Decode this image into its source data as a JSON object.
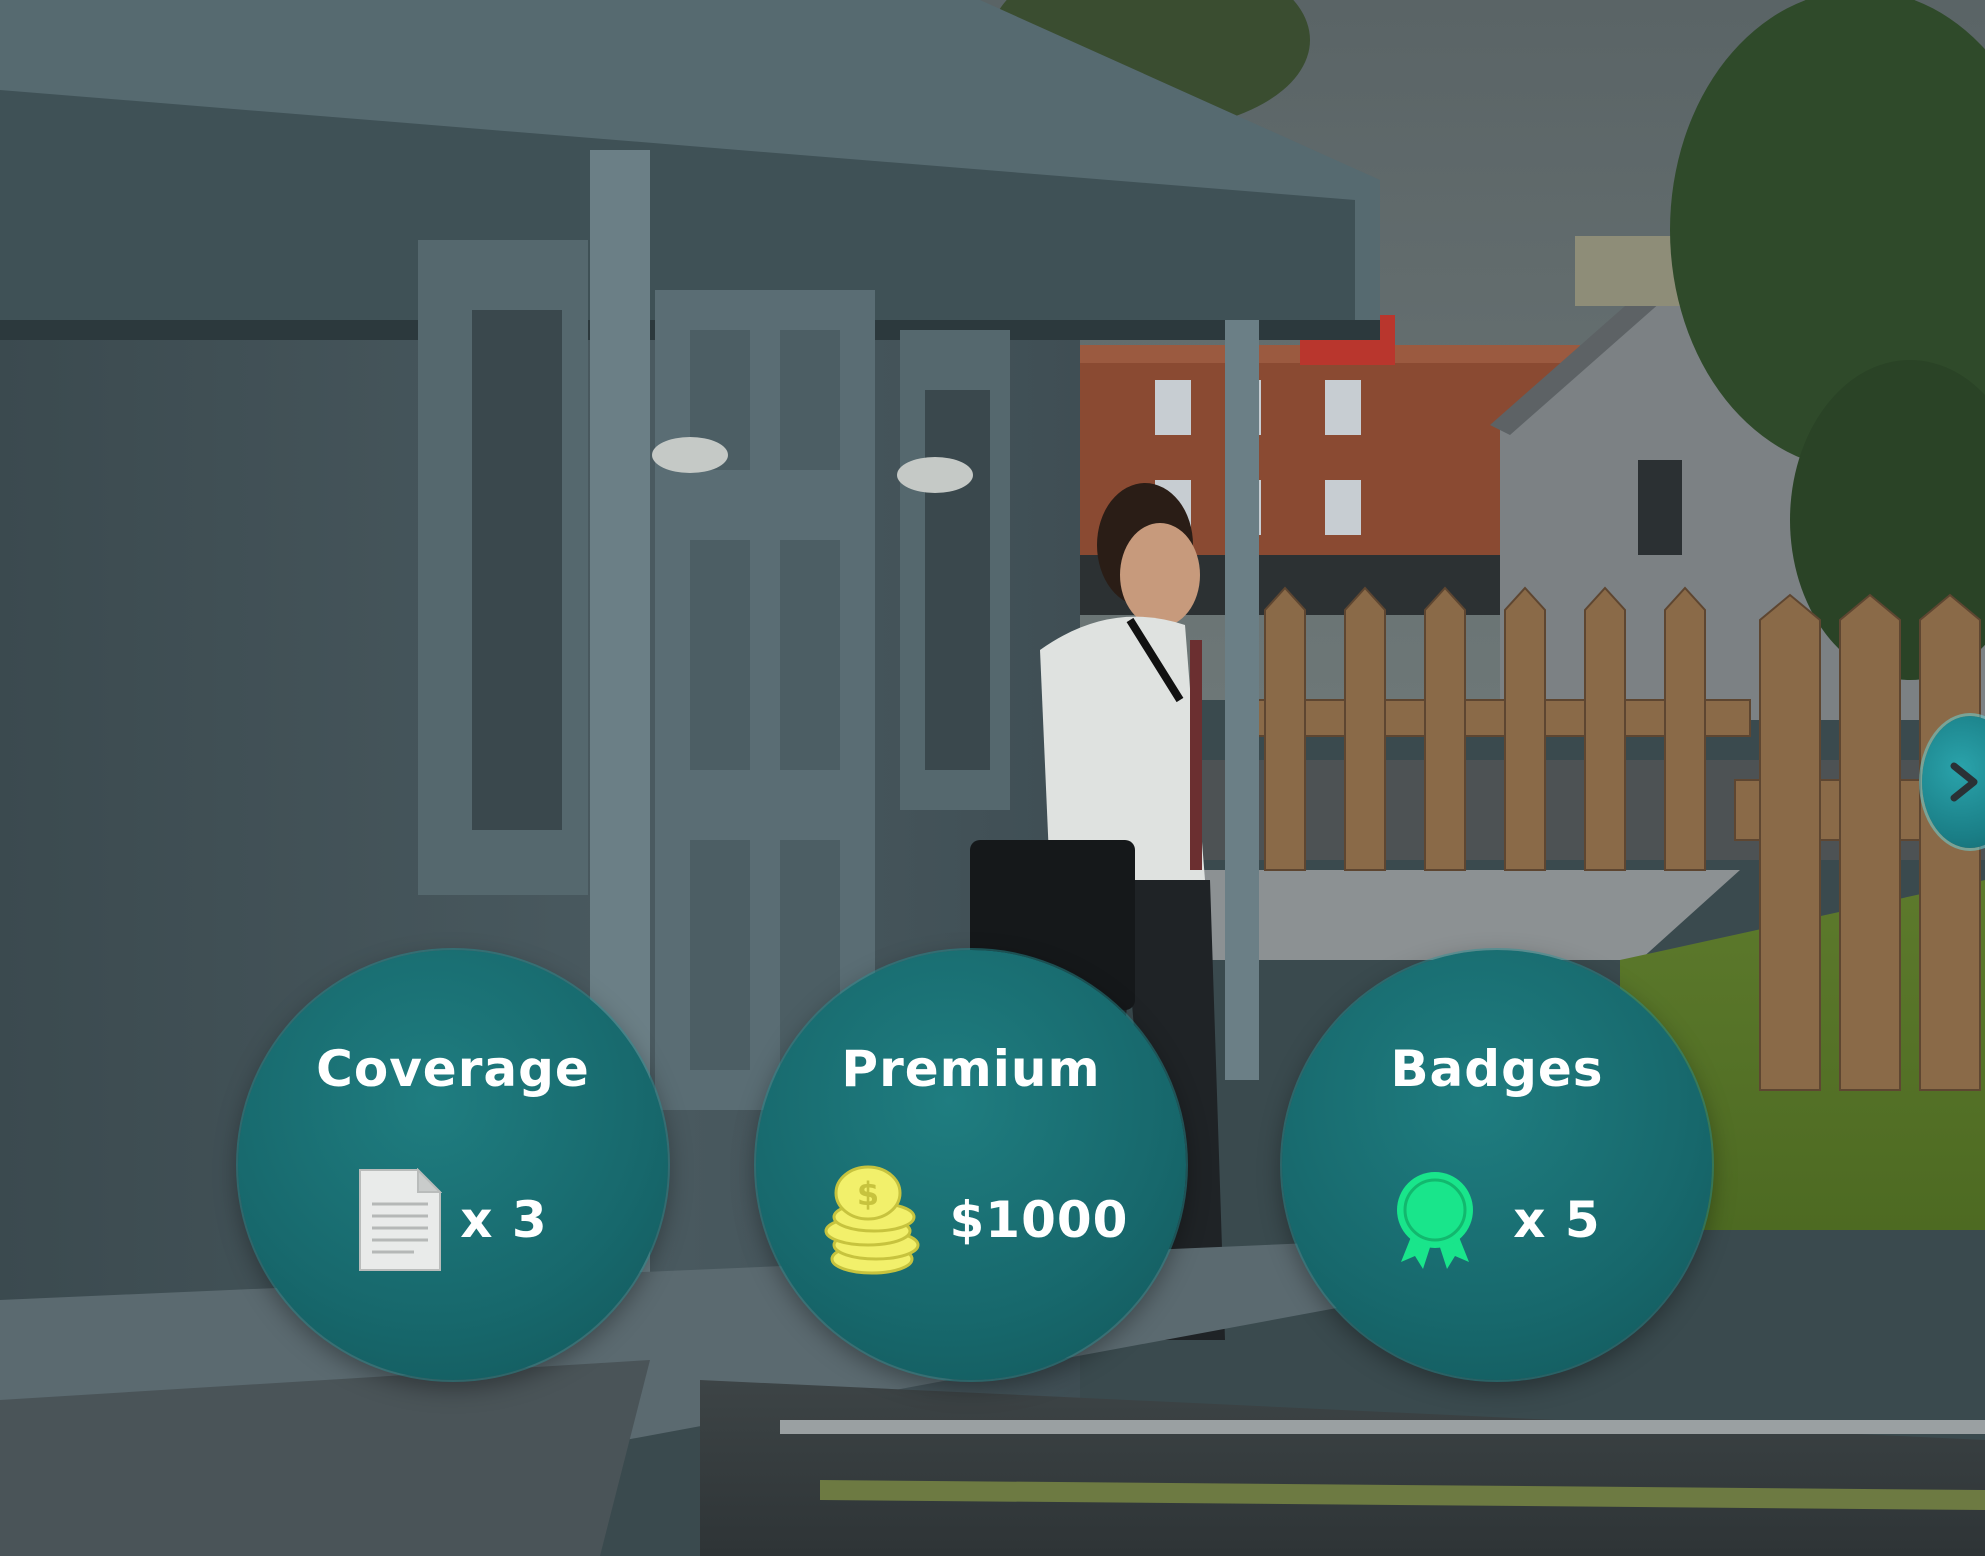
{
  "hud": {
    "coverage": {
      "label": "Coverage",
      "value": "x 3",
      "icon": "document-icon"
    },
    "premium": {
      "label": "Premium",
      "value": "$1000",
      "icon": "coin-stack-icon"
    },
    "badges": {
      "label": "Badges",
      "value": "x 5",
      "icon": "ribbon-badge-icon"
    }
  },
  "navigation": {
    "next_icon": "chevron-right-icon"
  },
  "colors": {
    "accent": "#1c8a9a",
    "circle": "#17686c",
    "coin": "#f2f06b",
    "badge": "#19e58b"
  }
}
